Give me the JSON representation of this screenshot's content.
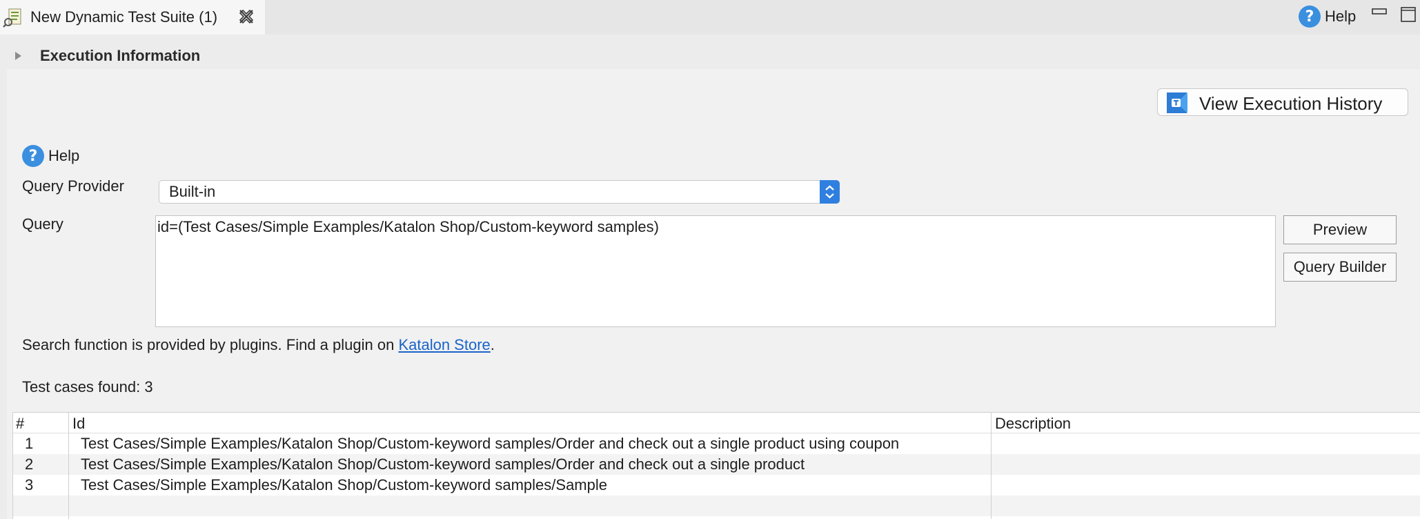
{
  "tab": {
    "title": "New Dynamic Test Suite (1)",
    "icon": "test-suite-icon",
    "close_icon": "close-icon"
  },
  "window": {
    "help_label": "Help"
  },
  "section": {
    "title": "Execution Information"
  },
  "toolbar": {
    "history_label": "View Execution History"
  },
  "help": {
    "label": "Help"
  },
  "form": {
    "provider_label": "Query Provider",
    "provider_value": "Built-in",
    "query_label": "Query",
    "query_value": "id=(Test Cases/Simple Examples/Katalon Shop/Custom-keyword samples)",
    "preview_label": "Preview",
    "builder_label": "Query Builder"
  },
  "info": {
    "text": "Search function is provided by plugins. Find a plugin on ",
    "link": "Katalon Store",
    "suffix": "."
  },
  "results": {
    "found": "Test cases found: 3",
    "columns": [
      "#",
      "Id",
      "Description"
    ],
    "rows": [
      {
        "num": "1",
        "id": "Test Cases/Simple Examples/Katalon Shop/Custom-keyword samples/Order and check out a single product using coupon",
        "desc": ""
      },
      {
        "num": "2",
        "id": "Test Cases/Simple Examples/Katalon Shop/Custom-keyword samples/Order and check out a single product",
        "desc": ""
      },
      {
        "num": "3",
        "id": "Test Cases/Simple Examples/Katalon Shop/Custom-keyword samples/Sample",
        "desc": ""
      }
    ]
  },
  "colors": {
    "accent": "#2f7fe0",
    "help_blue": "#3b8fdf",
    "link": "#1a63c9"
  }
}
